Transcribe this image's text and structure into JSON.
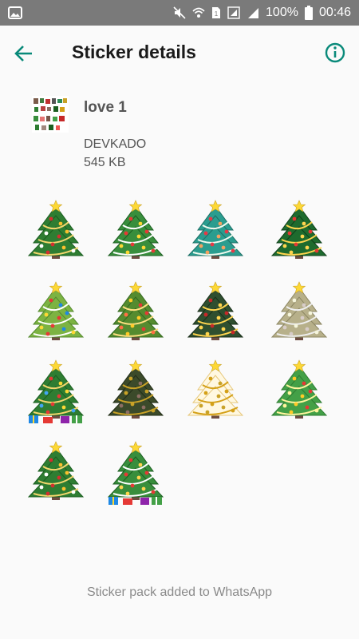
{
  "status_bar": {
    "battery": "100%",
    "time": "00:46"
  },
  "toolbar": {
    "title": "Sticker details",
    "back_icon": "arrow-back-icon",
    "info_icon": "info-icon"
  },
  "pack": {
    "name": "love 1",
    "publisher": "DEVKADO",
    "size": "545 KB"
  },
  "stickers": [
    {
      "kind": "classic"
    },
    {
      "kind": "snowy"
    },
    {
      "kind": "teal"
    },
    {
      "kind": "gold-garland"
    },
    {
      "kind": "bright"
    },
    {
      "kind": "lit"
    },
    {
      "kind": "dark-lit"
    },
    {
      "kind": "frosted"
    },
    {
      "kind": "gifts"
    },
    {
      "kind": "dark-pine"
    },
    {
      "kind": "white-gold"
    },
    {
      "kind": "lit-green"
    },
    {
      "kind": "classic"
    },
    {
      "kind": "gifts-lit"
    }
  ],
  "footer": {
    "message": "Sticker pack added to WhatsApp"
  },
  "colors": {
    "accent": "#0a8a7a",
    "status_bar": "#7a7a7a"
  }
}
